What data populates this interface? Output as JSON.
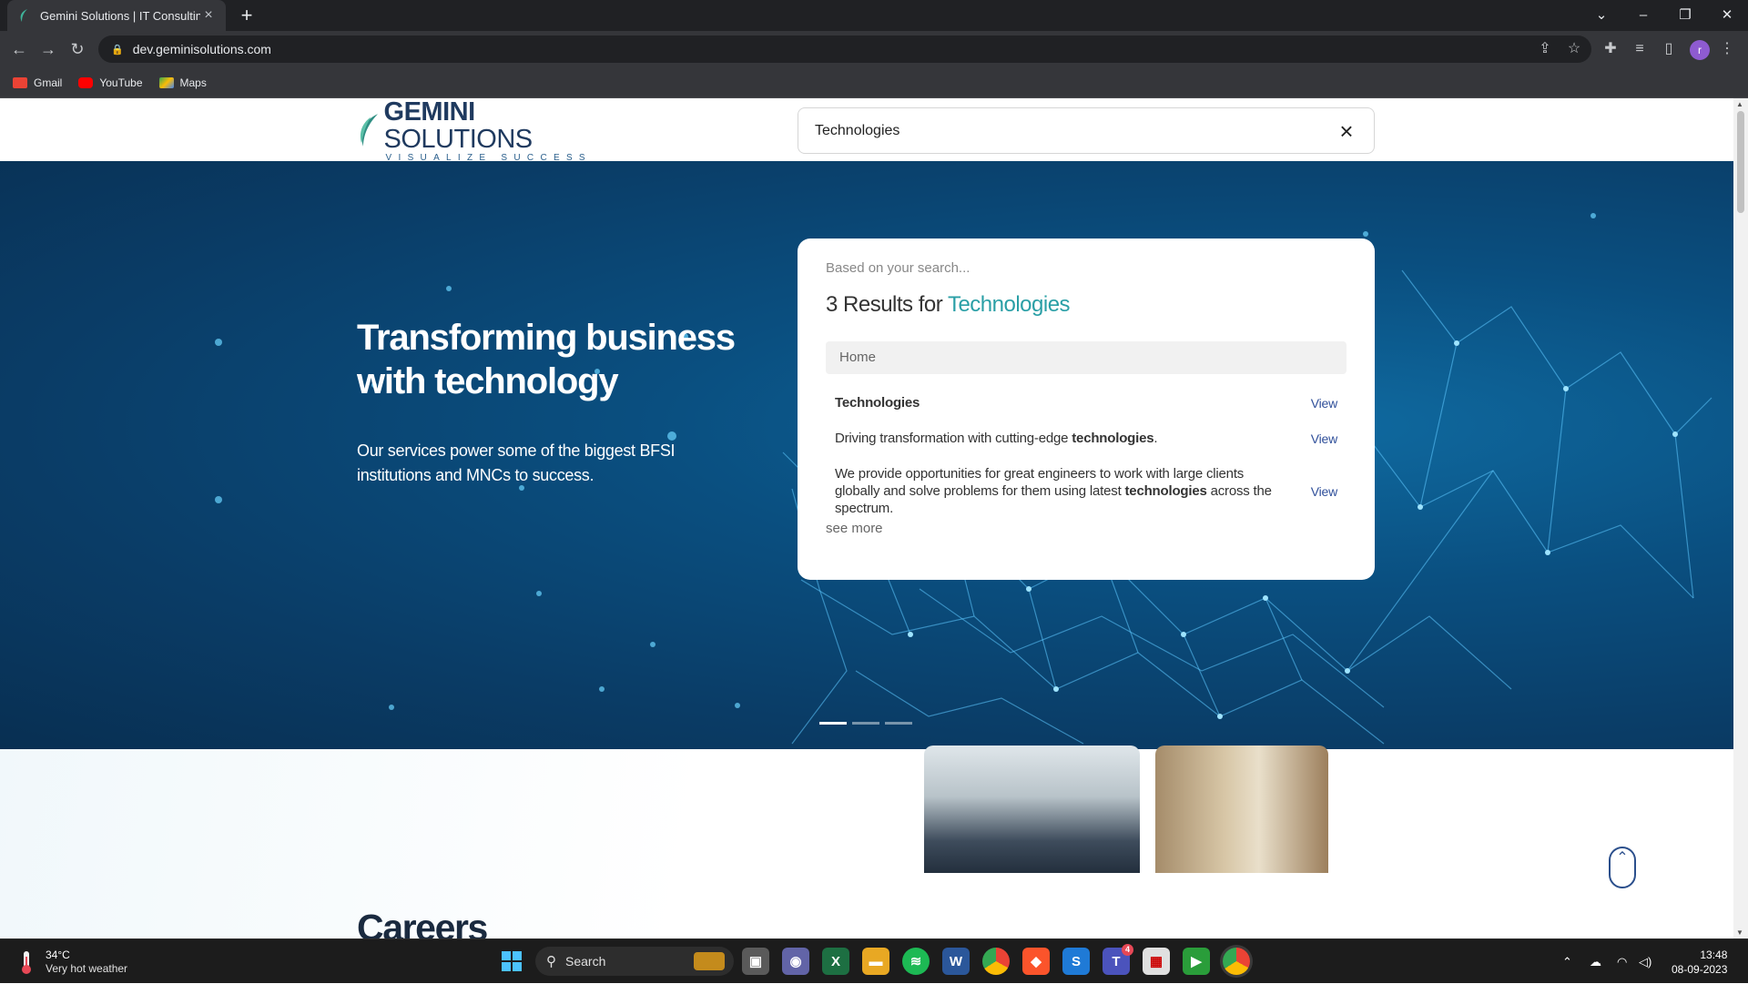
{
  "browser": {
    "tab_title": "Gemini Solutions | IT Consulting,",
    "url": "dev.geminisolutions.com",
    "profile_initial": "r",
    "bookmarks": [
      {
        "label": "Gmail",
        "color": "#ea4335"
      },
      {
        "label": "YouTube",
        "color": "#ff0000"
      },
      {
        "label": "Maps",
        "color": "#34a853"
      }
    ]
  },
  "site": {
    "logo_name_bold": "GEMINI",
    "logo_name_rest": " SOLUTIONS",
    "logo_tagline": "VISUALIZE SUCCESS",
    "search_value": "Technologies",
    "hero_title": "Transforming business with technology",
    "hero_text": "Our services power some of the biggest BFSI institutions and MNCs to success.",
    "slides": 3,
    "active_slide": 1,
    "careers_title": "Careers"
  },
  "search_results": {
    "hint": "Based on your search...",
    "count_prefix": "3 Results for ",
    "term": "Technologies",
    "group": "Home",
    "view_label": "View",
    "see_more": "see more",
    "items": [
      {
        "before": "",
        "match": "Technologies",
        "after": ""
      },
      {
        "before": "Driving transformation with cutting-edge ",
        "match": "technologies",
        "after": "."
      },
      {
        "before": "We provide opportunities for great engineers to work with large clients globally and solve problems for them using latest ",
        "match": "technologies",
        "after": " across the spectrum."
      }
    ]
  },
  "taskbar": {
    "temperature": "34°C",
    "weather": "Very hot weather",
    "search_label": "Search",
    "time": "13:48",
    "date": "08-09-2023",
    "teams_badge": "4"
  },
  "colors": {
    "accent_teal": "#2a9fa6",
    "link_blue": "#2f4f9a",
    "hero_blue": "#0a4f80"
  }
}
